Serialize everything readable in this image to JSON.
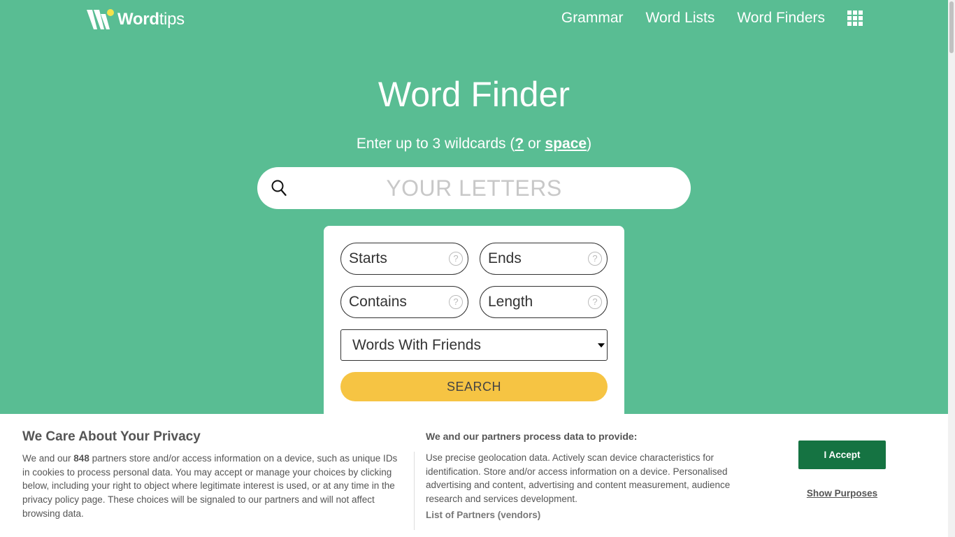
{
  "header": {
    "logo_text_bold": "Word",
    "logo_text_rest": "tips",
    "nav": [
      {
        "label": "Grammar"
      },
      {
        "label": "Word Lists"
      },
      {
        "label": "Word Finders"
      }
    ],
    "menu_icon": "grid-icon"
  },
  "hero": {
    "title": "Word Finder",
    "subtitle_prefix": "Enter up to 3 wildcards (",
    "wildcard_question": "?",
    "subtitle_or": " or ",
    "wildcard_space": "space",
    "subtitle_suffix": ")",
    "search_placeholder": "YOUR LETTERS",
    "search_value": ""
  },
  "filters": {
    "starts_placeholder": "Starts",
    "ends_placeholder": "Ends",
    "contains_placeholder": "Contains",
    "length_placeholder": "Length",
    "help_glyph": "?",
    "dictionary_selected": "Words With Friends",
    "search_button": "SEARCH"
  },
  "consent": {
    "title": "We Care About Your Privacy",
    "desc_prefix": "We and our ",
    "partner_count": "848",
    "desc_suffix": " partners store and/or access information on a device, such as unique IDs in cookies to process personal data. You may accept or manage your choices by clicking below, including your right to object where legitimate interest is used, or at any time in the privacy policy page. These choices will be signaled to our partners and will not affect browsing data.",
    "purposes_title": "We and our partners process data to provide:",
    "purposes_text": "Use precise geolocation data. Actively scan device characteristics for identification. Store and/or access information on a device. Personalised advertising and content, advertising and content measurement, audience research and services development.",
    "vendors_link": "List of Partners (vendors)",
    "accept_button": "I Accept",
    "show_purposes": "Show Purposes"
  },
  "colors": {
    "background": "#59bd93",
    "accent_yellow": "#f6c443",
    "accept_green": "#157342"
  }
}
